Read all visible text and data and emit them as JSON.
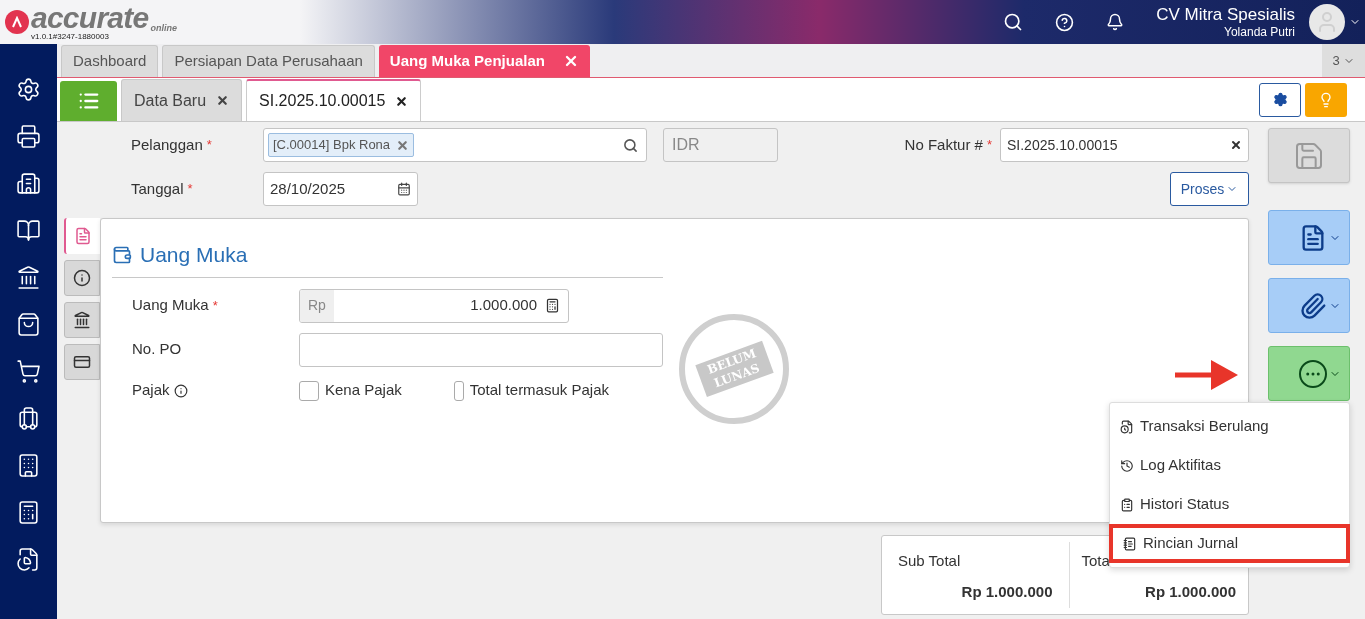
{
  "header": {
    "logo_text": "accurate",
    "logo_sub": "online",
    "version": "v1.0.1#3247-1880003",
    "company": "CV Mitra Spesialis",
    "user": "Yolanda Putri"
  },
  "main_tabs": [
    {
      "label": "Dashboard",
      "selected": false,
      "closable": false
    },
    {
      "label": "Persiapan Data Perusahaan",
      "selected": false,
      "closable": false
    },
    {
      "label": "Uang Muka Penjualan",
      "selected": true,
      "closable": true
    }
  ],
  "tab_count": "3",
  "sub_tabs": [
    {
      "label": "Data Baru",
      "selected": false
    },
    {
      "label": "SI.2025.10.00015",
      "selected": true
    }
  ],
  "form": {
    "pelanggan": {
      "label": "Pelanggan",
      "required_mark": "*",
      "tag": "[C.00014] Bpk Rona"
    },
    "currency": {
      "placeholder": "IDR"
    },
    "no_faktur": {
      "label": "No Faktur #",
      "required_mark": "*",
      "value": "SI.2025.10.00015"
    },
    "tanggal": {
      "label": "Tanggal",
      "required_mark": "*",
      "value": "28/10/2025"
    },
    "proses_button": "Proses"
  },
  "side_tabs": [
    {
      "selected": true
    },
    {
      "selected": false
    },
    {
      "selected": false
    },
    {
      "selected": false
    }
  ],
  "card": {
    "title": "Uang Muka",
    "uang_muka": {
      "label": "Uang Muka",
      "required_mark": "*",
      "prefix": "Rp",
      "value": "1.000.000"
    },
    "no_po": {
      "label": "No. PO"
    },
    "pajak": {
      "label": "Pajak",
      "options": [
        {
          "label": "Kena Pajak",
          "checked": false
        },
        {
          "label": "Total termasuk Pajak",
          "checked": false
        }
      ]
    },
    "stamp": [
      "BELUM",
      "LUNAS"
    ]
  },
  "summary": [
    {
      "label": "Sub Total",
      "value": "Rp 1.000.000"
    },
    {
      "label": "Tota",
      "value": "Rp 1.000.000"
    }
  ],
  "menu": [
    {
      "label": "Transaksi Berulang",
      "highlighted": false
    },
    {
      "label": "Log Aktifitas",
      "highlighted": false
    },
    {
      "label": "Histori Status",
      "highlighted": false
    },
    {
      "label": "Rincian Jurnal",
      "highlighted": true
    }
  ]
}
